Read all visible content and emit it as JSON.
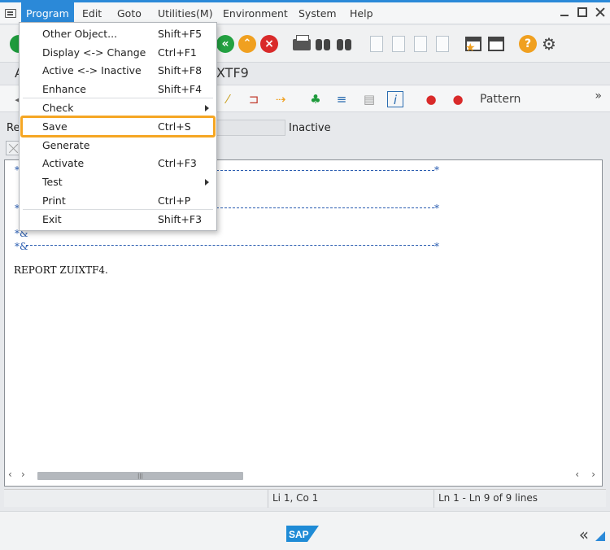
{
  "menubar": {
    "items": [
      "Program",
      "Edit",
      "Goto",
      "Utilities(M)",
      "Environment",
      "System",
      "Help"
    ]
  },
  "title": {
    "left": "A",
    "right": "XTF9"
  },
  "app_toolbar": {
    "pattern_label": "Pattern"
  },
  "info": {
    "left_label": "Re",
    "status": "Inactive"
  },
  "dropdown": {
    "items": [
      {
        "label": "Other Object...",
        "shortcut": "Shift+F5"
      },
      {
        "label": "Display <-> Change",
        "shortcut": "Ctrl+F1"
      },
      {
        "label": "Active <-> Inactive",
        "shortcut": "Shift+F8"
      },
      {
        "label": "Enhance",
        "shortcut": "Shift+F4"
      },
      {
        "label": "Check",
        "shortcut": ""
      },
      {
        "label": "Save",
        "shortcut": "Ctrl+S"
      },
      {
        "label": "Generate",
        "shortcut": ""
      },
      {
        "label": "Activate",
        "shortcut": "Ctrl+F3"
      },
      {
        "label": "Test",
        "shortcut": ""
      },
      {
        "label": "Print",
        "shortcut": "Ctrl+P"
      },
      {
        "label": "Exit",
        "shortcut": "Shift+F3"
      }
    ]
  },
  "editor": {
    "comment_marks": [
      "*",
      "*",
      "*",
      "*",
      "*&",
      "*&"
    ],
    "code": "REPORT   ZUIXTF4."
  },
  "statusbar": {
    "cursor": "Li 1, Co 1",
    "lines": "Ln 1 - Ln 9 of 9 lines"
  },
  "footer": {
    "logo_text": "SAP"
  },
  "colors": {
    "accent": "#2b89d8",
    "highlight": "#f5a623"
  }
}
